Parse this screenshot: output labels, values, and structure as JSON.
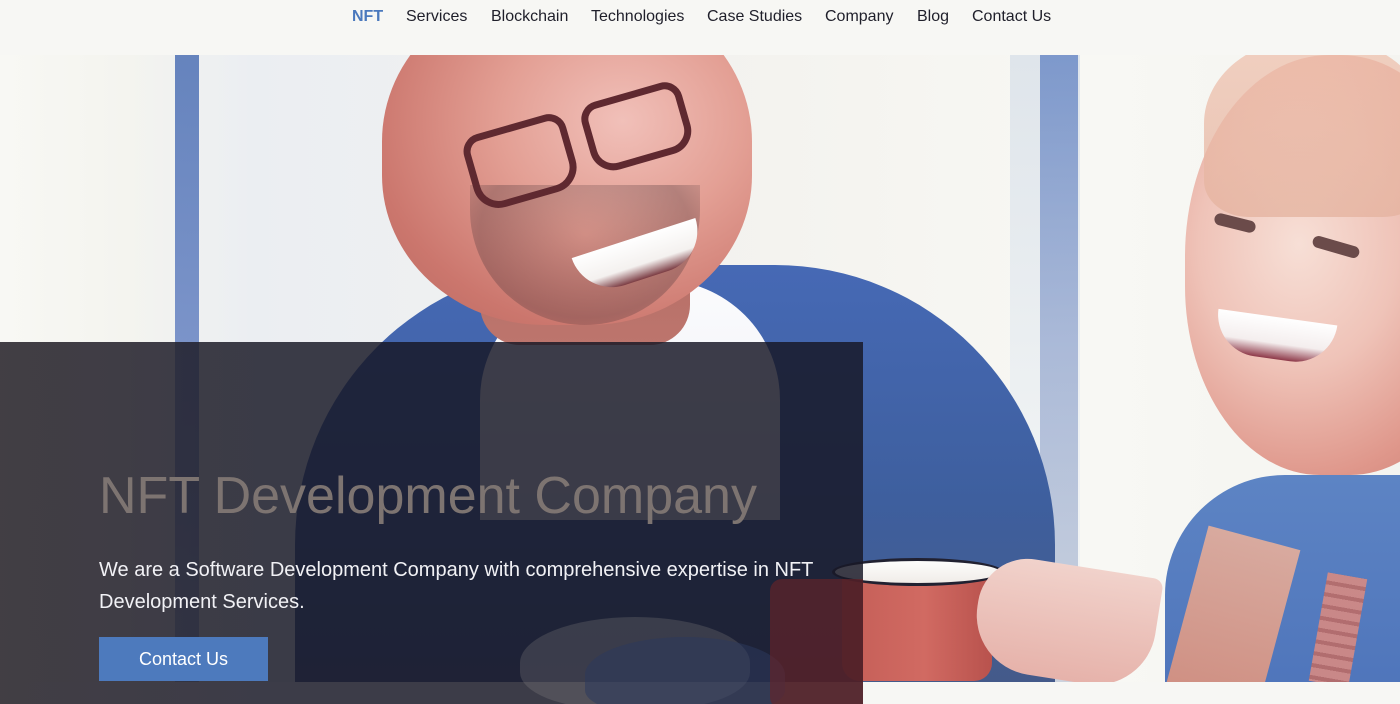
{
  "nav": {
    "items": [
      {
        "label": "NFT",
        "active": true
      },
      {
        "label": "Services",
        "active": false
      },
      {
        "label": "Blockchain",
        "active": false
      },
      {
        "label": "Technologies",
        "active": false
      },
      {
        "label": "Case Studies",
        "active": false
      },
      {
        "label": "Company",
        "active": false
      },
      {
        "label": "Blog",
        "active": false
      },
      {
        "label": "Contact Us",
        "active": false
      }
    ]
  },
  "hero": {
    "title": "NFT Development Company",
    "subtitle": "We are a Software Development Company with comprehensive expertise in NFT Development Services.",
    "button_label": "Contact Us"
  },
  "colors": {
    "accent": "#4d7abd",
    "nav_active": "#4b79bd",
    "panel": "#181826",
    "page_background": "#f7f7f4"
  }
}
